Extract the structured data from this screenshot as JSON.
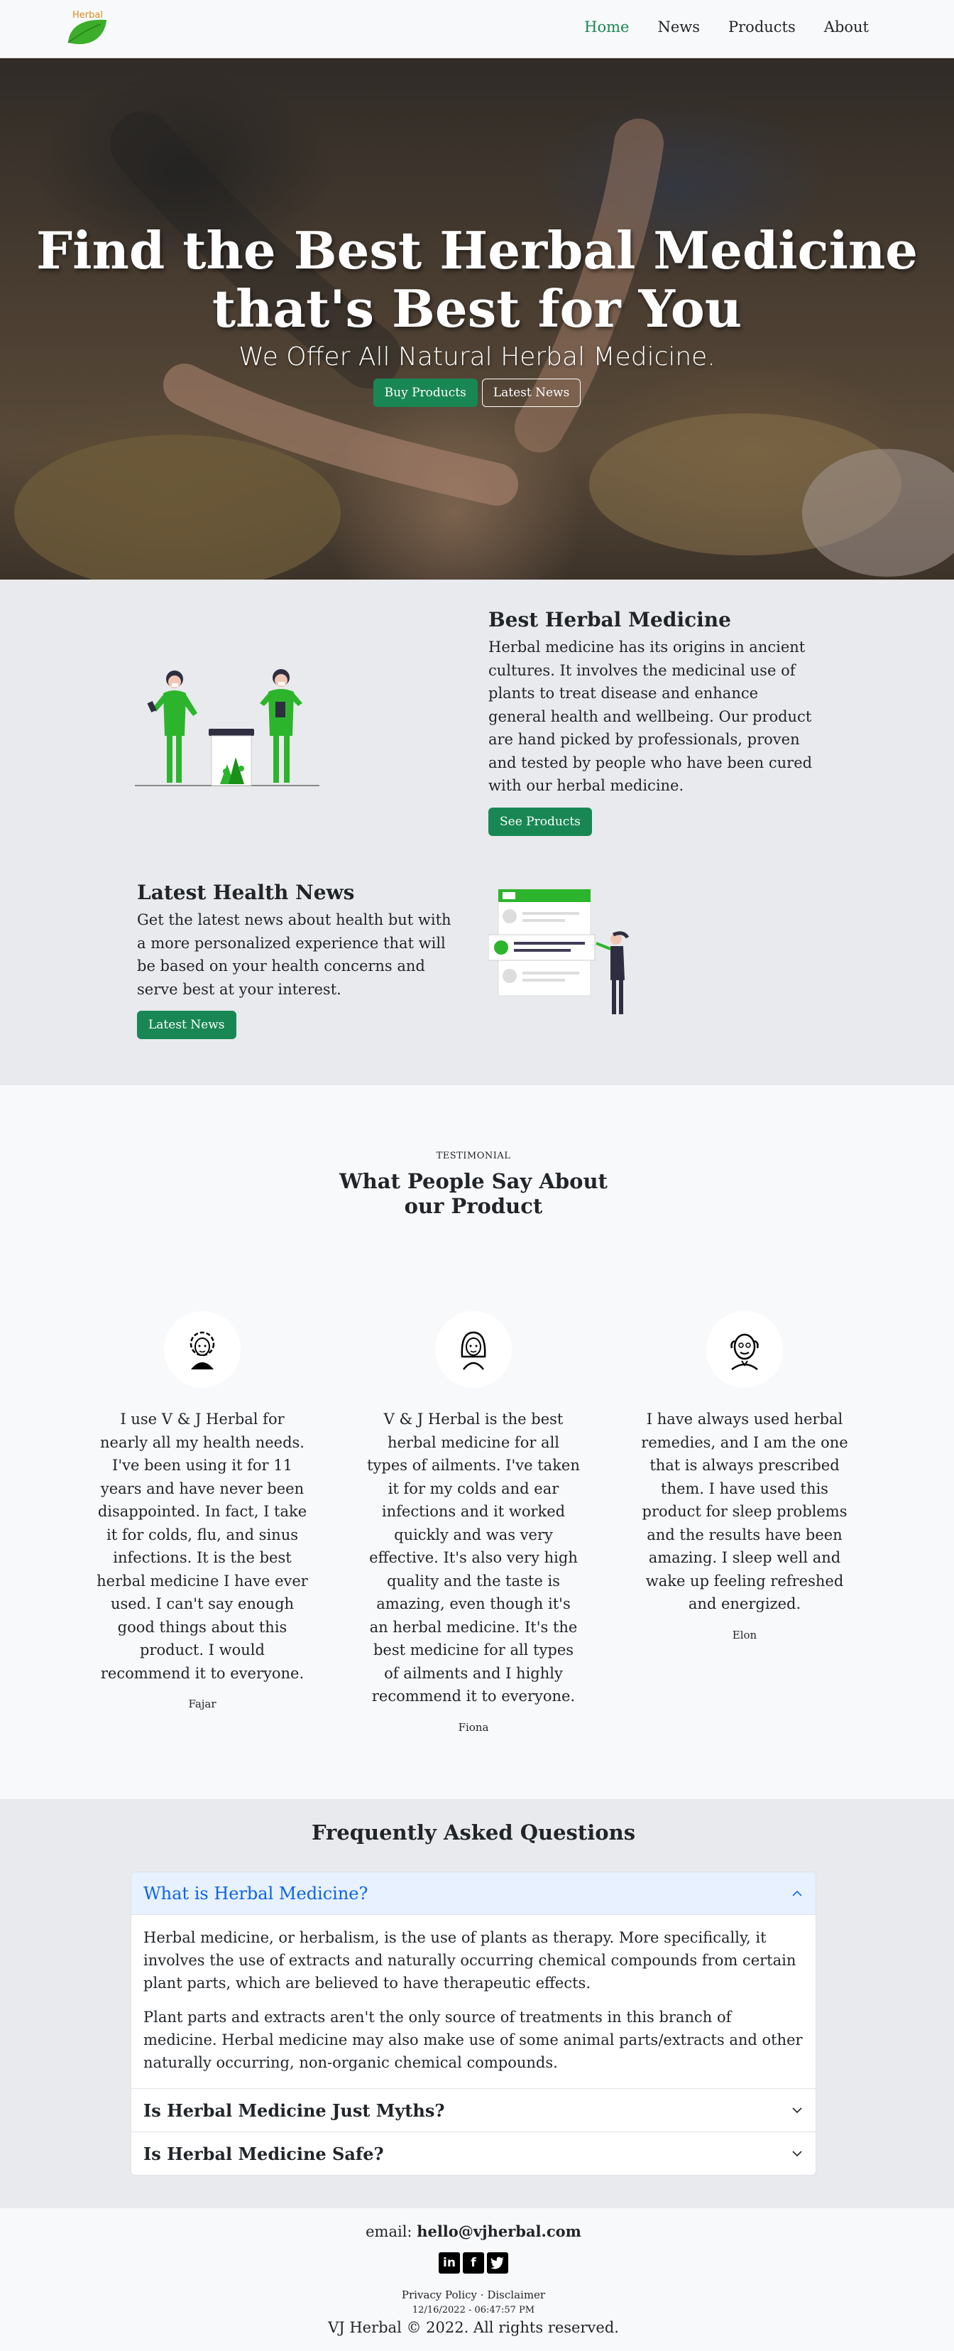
{
  "brand": {
    "logo_text": "Herbal"
  },
  "nav": {
    "items": [
      {
        "label": "Home",
        "active": true
      },
      {
        "label": "News",
        "active": false
      },
      {
        "label": "Products",
        "active": false
      },
      {
        "label": "About",
        "active": false
      }
    ]
  },
  "hero": {
    "title_line1": "Find the Best Herbal Medicine",
    "title_line2": "that's Best for You",
    "subtitle": "We Offer All Natural Herbal Medicine.",
    "primary_button": "Buy Products",
    "secondary_button": "Latest News"
  },
  "features": {
    "first": {
      "title": "Best Herbal Medicine",
      "text": "Herbal medicine has its origins in ancient cultures. It involves the medicinal use of plants to treat disease and enhance general health and wellbeing. Our product are hand picked by professionals, proven and tested by people who have been cured with our herbal medicine.",
      "button": "See Products"
    },
    "second": {
      "title": "Latest Health News",
      "text": "Get the latest news about health but with a more personalized experience that will be based on your health concerns and serve best at your interest.",
      "button": "Latest News"
    }
  },
  "testimonials": {
    "label": "TESTIMONIAL",
    "title": "What People Say About our Product",
    "items": [
      {
        "quote": "I use V & J Herbal for nearly all my health needs. I've been using it for 11 years and have never been disappointed. In fact, I take it for colds, flu, and sinus infections. It is the best herbal medicine I have ever used. I can't say enough good things about this product. I would recommend it to everyone.",
        "name": "Fajar"
      },
      {
        "quote": "V & J Herbal is the best herbal medicine for all types of ailments. I've taken it for my colds and ear infections and it worked quickly and was very effective. It's also very high quality and the taste is amazing, even though it's an herbal medicine. It's the best medicine for all types of ailments and I highly recommend it to everyone.",
        "name": "Fiona"
      },
      {
        "quote": "I have always used herbal remedies, and I am the one that is always prescribed them. I have used this product for sleep problems and the results have been amazing. I sleep well and wake up feeling refreshed and energized.",
        "name": "Elon"
      }
    ]
  },
  "faq": {
    "title": "Frequently Asked Questions",
    "items": [
      {
        "question": "What is Herbal Medicine?",
        "open": true,
        "answer_p1": "Herbal medicine, or herbalism, is the use of plants as therapy. More specifically, it involves the use of extracts and naturally occurring chemical compounds from certain plant parts, which are believed to have therapeutic effects.",
        "answer_p2": "Plant parts and extracts aren't the only source of treatments in this branch of medicine. Herbal medicine may also make use of some animal parts/extracts and other naturally occurring, non-organic chemical compounds."
      },
      {
        "question": "Is Herbal Medicine Just Myths?",
        "open": false
      },
      {
        "question": "Is Herbal Medicine Safe?",
        "open": false
      }
    ]
  },
  "footer": {
    "email_label": "email:",
    "email": "hello@vjherbal.com",
    "social": [
      {
        "icon": "linkedin-icon",
        "glyph": "in"
      },
      {
        "icon": "facebook-icon",
        "glyph": "f"
      },
      {
        "icon": "twitter-icon",
        "glyph": "t"
      }
    ],
    "privacy": "Privacy Policy",
    "separator": "·",
    "disclaimer": "Disclaimer",
    "timestamp": "12/16/2022 - 06:47:57 PM",
    "copyright": "VJ Herbal © 2022. All rights reserved."
  },
  "colors": {
    "brand_green": "#198754",
    "accordion_active": "#0c63e4",
    "section_gray": "#e9eaed"
  }
}
